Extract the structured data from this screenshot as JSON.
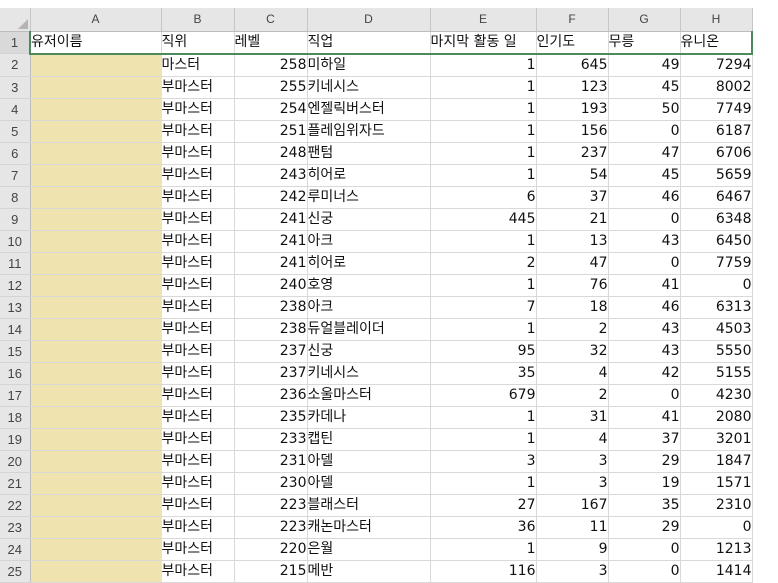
{
  "columns": [
    "A",
    "B",
    "C",
    "D",
    "E",
    "F",
    "G",
    "H"
  ],
  "header": [
    "유저이름",
    "직위",
    "레벨",
    "직업",
    "마지막 활동 일",
    "인기도",
    "무릉",
    "유니온"
  ],
  "rows": [
    {
      "n": "2",
      "v": [
        "",
        "마스터",
        "258",
        "미하일",
        "1",
        "645",
        "49",
        "7294"
      ]
    },
    {
      "n": "3",
      "v": [
        "",
        "부마스터",
        "255",
        "키네시스",
        "1",
        "123",
        "45",
        "8002"
      ]
    },
    {
      "n": "4",
      "v": [
        "",
        "부마스터",
        "254",
        "엔젤릭버스터",
        "1",
        "193",
        "50",
        "7749"
      ]
    },
    {
      "n": "5",
      "v": [
        "",
        "부마스터",
        "251",
        "플레임위자드",
        "1",
        "156",
        "0",
        "6187"
      ]
    },
    {
      "n": "6",
      "v": [
        "",
        "부마스터",
        "248",
        "팬텀",
        "1",
        "237",
        "47",
        "6706"
      ]
    },
    {
      "n": "7",
      "v": [
        "",
        "부마스터",
        "243",
        "히어로",
        "1",
        "54",
        "45",
        "5659"
      ]
    },
    {
      "n": "8",
      "v": [
        "",
        "부마스터",
        "242",
        "루미너스",
        "6",
        "37",
        "46",
        "6467"
      ]
    },
    {
      "n": "9",
      "v": [
        "",
        "부마스터",
        "241",
        "신궁",
        "445",
        "21",
        "0",
        "6348"
      ]
    },
    {
      "n": "10",
      "v": [
        "",
        "부마스터",
        "241",
        "아크",
        "1",
        "13",
        "43",
        "6450"
      ]
    },
    {
      "n": "11",
      "v": [
        "",
        "부마스터",
        "241",
        "히어로",
        "2",
        "47",
        "0",
        "7759"
      ]
    },
    {
      "n": "12",
      "v": [
        "",
        "부마스터",
        "240",
        "호영",
        "1",
        "76",
        "41",
        "0"
      ]
    },
    {
      "n": "13",
      "v": [
        "",
        "부마스터",
        "238",
        "아크",
        "7",
        "18",
        "46",
        "6313"
      ]
    },
    {
      "n": "14",
      "v": [
        "",
        "부마스터",
        "238",
        "듀얼블레이더",
        "1",
        "2",
        "43",
        "4503"
      ]
    },
    {
      "n": "15",
      "v": [
        "",
        "부마스터",
        "237",
        "신궁",
        "95",
        "32",
        "43",
        "5550"
      ]
    },
    {
      "n": "16",
      "v": [
        "",
        "부마스터",
        "237",
        "키네시스",
        "35",
        "4",
        "42",
        "5155"
      ]
    },
    {
      "n": "17",
      "v": [
        "",
        "부마스터",
        "236",
        "소울마스터",
        "679",
        "2",
        "0",
        "4230"
      ]
    },
    {
      "n": "18",
      "v": [
        "",
        "부마스터",
        "235",
        "카데나",
        "1",
        "31",
        "41",
        "2080"
      ]
    },
    {
      "n": "19",
      "v": [
        "",
        "부마스터",
        "233",
        "캡틴",
        "1",
        "4",
        "37",
        "3201"
      ]
    },
    {
      "n": "20",
      "v": [
        "",
        "부마스터",
        "231",
        "아델",
        "3",
        "3",
        "29",
        "1847"
      ]
    },
    {
      "n": "21",
      "v": [
        "",
        "부마스터",
        "230",
        "아델",
        "1",
        "3",
        "19",
        "1571"
      ]
    },
    {
      "n": "22",
      "v": [
        "",
        "부마스터",
        "223",
        "블래스터",
        "27",
        "167",
        "35",
        "2310"
      ]
    },
    {
      "n": "23",
      "v": [
        "",
        "부마스터",
        "223",
        "캐논마스터",
        "36",
        "11",
        "29",
        "0"
      ]
    },
    {
      "n": "24",
      "v": [
        "",
        "부마스터",
        "220",
        "은월",
        "1",
        "9",
        "0",
        "1213"
      ]
    },
    {
      "n": "25",
      "v": [
        "",
        "부마스터",
        "215",
        "메반",
        "116",
        "3",
        "0",
        "1414"
      ]
    }
  ],
  "colors": {
    "highlight_column_a": "#efe4b0",
    "header_bg": "#e6e6e6",
    "selection_border": "#4c8a5c"
  }
}
